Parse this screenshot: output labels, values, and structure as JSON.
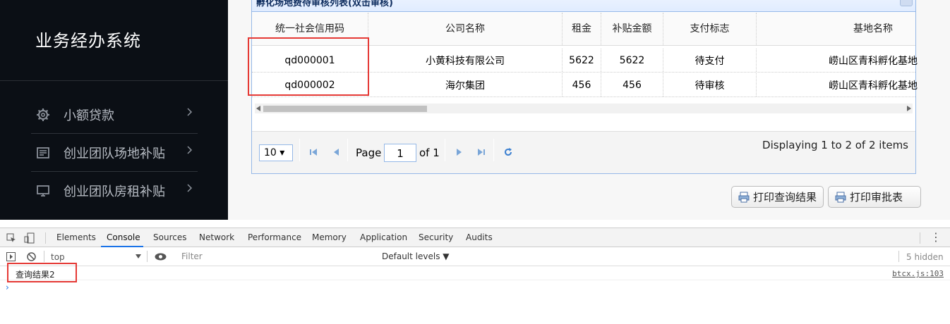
{
  "sidebar": {
    "title": "业务经办系统",
    "items": [
      {
        "label": "小额贷款",
        "icon": "gear-icon"
      },
      {
        "label": "创业团队场地补贴",
        "icon": "document-icon"
      },
      {
        "label": "创业团队房租补贴",
        "icon": "monitor-icon"
      }
    ]
  },
  "panel": {
    "title": "孵化场地费待审核列表(双击审核)"
  },
  "grid": {
    "columns": [
      "统一社会信用码",
      "公司名称",
      "租金",
      "补贴金额",
      "支付标志",
      "基地名称"
    ],
    "rows": [
      [
        "qd000001",
        "小黄科技有限公司",
        "5622",
        "5622",
        "待支付",
        "崂山区青科孵化基地"
      ],
      [
        "qd000002",
        "海尔集团",
        "456",
        "456",
        "待审核",
        "崂山区青科孵化基地"
      ]
    ]
  },
  "pager": {
    "page_size": "10 ▾",
    "page_label": "Page",
    "page_value": "1",
    "of_label": "of 1",
    "info": "Displaying 1 to 2 of 2 items"
  },
  "buttons": {
    "print_query": "打印查询结果",
    "print_approval": "打印审批表"
  },
  "devtools": {
    "tabs": [
      "Elements",
      "Console",
      "Sources",
      "Network",
      "Performance",
      "Memory",
      "Application",
      "Security",
      "Audits"
    ],
    "context": "top",
    "filter_placeholder": "Filter",
    "levels": "Default levels ▼",
    "hidden": "5 hidden",
    "console_message": "查询结果2",
    "console_source": "btcx.js:103",
    "prompt": "›"
  },
  "colors": {
    "sidebar_bg": "#0b0f15",
    "highlight_box": "#e53935",
    "panel_border": "#95b8e7",
    "devtools_accent": "#1a73e8"
  }
}
